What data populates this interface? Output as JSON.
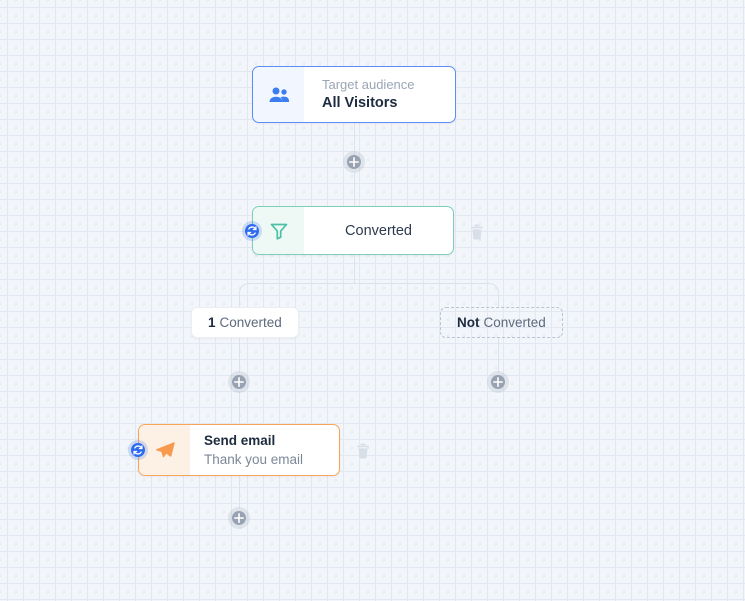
{
  "canvas": {
    "background_color": "#f2f5f9",
    "grid_dot_color": "#dfe6ef"
  },
  "flow": {
    "audience_node": {
      "icon": "users-icon",
      "icon_color": "#3c7ef0",
      "accent_color": "#5b8df6",
      "label": "Target audience",
      "value": "All Visitors"
    },
    "filter_node": {
      "icon": "funnel-icon",
      "icon_color": "#4cbfa6",
      "accent_color": "#7ecfba",
      "title": "Converted",
      "sync_badge": "sync-icon",
      "delete_icon": "trash-icon"
    },
    "branches": [
      {
        "count": "1",
        "label": "Converted",
        "style": "solid"
      },
      {
        "count": "Not",
        "label": "Converted",
        "style": "dashed"
      }
    ],
    "email_node": {
      "icon": "send-plane-icon",
      "icon_color": "#f89a4e",
      "accent_color": "#f8a55c",
      "title": "Send email",
      "subtitle": "Thank you email",
      "sync_badge": "sync-icon",
      "delete_icon": "trash-icon"
    },
    "add_buttons": [
      {
        "name": "add-step-after-audience",
        "symbol": "+"
      },
      {
        "name": "add-step-converted-branch",
        "symbol": "+"
      },
      {
        "name": "add-step-not-converted-branch",
        "symbol": "+"
      },
      {
        "name": "add-step-after-email",
        "symbol": "+"
      }
    ],
    "colors": {
      "connector": "#dbe2ec",
      "plus_button": "#98a2b3",
      "badge_blue": "#2f6bed",
      "text_dark": "#1d2b3f",
      "text_muted": "#9aa5b4"
    }
  }
}
